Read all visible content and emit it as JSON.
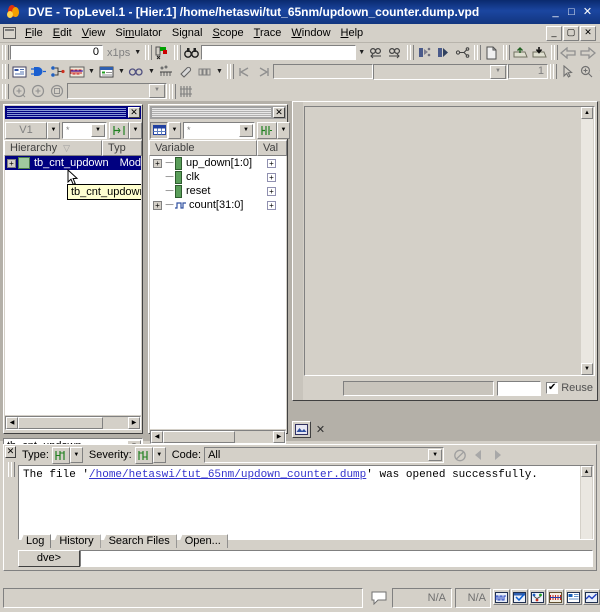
{
  "window": {
    "title": "DVE - TopLevel.1 - [Hier.1]  /home/hetaswi/tut_65nm/updown_counter.dump.vpd",
    "logo_icon": "dve-flame-logo-icon",
    "minimize_label": "_",
    "maximize_label": "□",
    "close_label": "✕"
  },
  "menubar": {
    "window_icon": "window-menu-icon",
    "items": [
      {
        "label": "File"
      },
      {
        "label": "Edit"
      },
      {
        "label": "View"
      },
      {
        "label": "Simulator"
      },
      {
        "label": "Signal"
      },
      {
        "label": "Scope"
      },
      {
        "label": "Trace"
      },
      {
        "label": "Window"
      },
      {
        "label": "Help"
      }
    ],
    "mdi_buttons": [
      {
        "label": "_",
        "name": "mdi-minimize-button"
      },
      {
        "label": "▢",
        "name": "mdi-restore-button"
      },
      {
        "label": "✕",
        "name": "mdi-close-button"
      }
    ]
  },
  "toolbar1": {
    "time_value": "0",
    "time_unit": "x1ps",
    "search_value": "",
    "goto_icon": "goto-time-icon",
    "find_icon": "binoculars-find-icon",
    "find_prev_icon": "find-prev-icon",
    "find_next_icon": "find-next-icon",
    "scope_combo_value": "",
    "add_signal_icon": "add-signal-icon",
    "add_group_icon": "add-group-icon",
    "expand_bus_icon": "expand-bus-icon",
    "new_file_icon": "new-file-icon",
    "open_db_icon": "open-database-icon",
    "save_db_icon": "save-database-icon",
    "back_icon": "navigate-back-icon",
    "forward_icon": "navigate-forward-icon"
  },
  "toolbar2": {
    "source_icon": "source-view-icon",
    "schematic_icon": "schematic-view-icon",
    "path_schematic_icon": "path-schematic-icon",
    "wave_icon": "wave-view-icon",
    "list_icon": "list-view-icon",
    "assertion_icon": "assertion-view-icon",
    "toggle_icon": "toggle-coverage-icon",
    "eraser_icon": "eraser-icon",
    "memory_icon": "memory-view-icon",
    "step_back_icon": "step-back-icon",
    "step_forward_icon": "step-forward-icon",
    "flat_field_value": ""
  },
  "toolbar3": {
    "zoom_out_icon": "zoom-out-circle-icon",
    "zoom_in_icon": "zoom-in-circle-icon",
    "zoom_fit_icon": "zoom-fit-circle-icon",
    "combo_value": "",
    "grid_icon": "grid-icon",
    "count_value": "1",
    "pointer_icon": "pointer-arrow-icon",
    "mag_plus_icon": "magnify-plus-icon",
    "mag_minus_icon": "magnify-minus-icon",
    "pan_hand_icon": "pan-hand-icon",
    "zoom_full_icon": "zoom-full-icon",
    "zoom_2x_icon": "zoom-2x-icon",
    "zoom_half_icon": "zoom-half-icon",
    "zoom_sel_icon": "zoom-selection-icon",
    "zoom_last_icon": "zoom-last-icon"
  },
  "hierarchy_window": {
    "close_label": "✕",
    "design_selector": "V1",
    "filter_value": "*",
    "filter_placeholder": "*",
    "expand_icon": "expand-all-icon",
    "columns": [
      {
        "label": "Hierarchy",
        "sort": "▽"
      },
      {
        "label": "Typ"
      }
    ],
    "rows": [
      {
        "name": "tb_cnt_updown",
        "type": "Mod",
        "selected": true,
        "expandable": true
      }
    ],
    "tooltip": "tb_cnt_updown",
    "status_value": "tb_cnt_updown"
  },
  "variable_window": {
    "close_label": "✕",
    "view_icon": "table-view-icon",
    "filter_value": "*",
    "filter_placeholder": "*",
    "expand_icon": "expand-all-icon",
    "columns": [
      {
        "label": "Variable"
      },
      {
        "label": "Val"
      }
    ],
    "rows": [
      {
        "name": "up_down[1:0]",
        "expandable": true,
        "kind": "signal",
        "value_btn": "+"
      },
      {
        "name": "clk",
        "expandable": false,
        "kind": "signal",
        "value_btn": "+"
      },
      {
        "name": "reset",
        "expandable": false,
        "kind": "signal",
        "value_btn": "+"
      },
      {
        "name": "count[31:0]",
        "expandable": true,
        "kind": "bus",
        "value_btn": "+"
      }
    ]
  },
  "right_pane": {
    "field_value": "",
    "small_field_value": "",
    "reuse_label": "Reuse",
    "reuse_checked": true,
    "reuse_mark": "✔",
    "tab_icon": "pane-tab-icon",
    "tab_close_label": "✕"
  },
  "log_panel": {
    "close_label": "✕",
    "type_label": "Type:",
    "type_icon": "type-filter-icon",
    "severity_label": "Severity:",
    "severity_icon": "severity-filter-icon",
    "code_label": "Code:",
    "code_value": "All",
    "clear_icon": "clear-messages-icon",
    "prev_icon": "prev-message-icon",
    "next_icon": "next-message-icon",
    "message_prefix": "The file '",
    "message_link": "/home/hetaswi/tut_65nm/updown_counter.dump",
    "message_suffix": "' was opened successfully.",
    "tabs": [
      {
        "label": "Log",
        "active": true
      },
      {
        "label": "History",
        "active": false
      },
      {
        "label": "Search Files",
        "active": false
      },
      {
        "label": "Open...",
        "active": false
      }
    ],
    "prompt_label": "dve>",
    "prompt_value": ""
  },
  "statusbar": {
    "message_icon": "message-balloon-icon",
    "field1": "N/A",
    "field2": "N/A",
    "icons": [
      {
        "name": "open-wave-window-icon"
      },
      {
        "name": "open-list-window-icon"
      },
      {
        "name": "open-schematic-window-icon"
      },
      {
        "name": "open-path-schematic-icon"
      },
      {
        "name": "open-source-window-icon"
      },
      {
        "name": "open-memory-window-icon"
      }
    ]
  },
  "colors": {
    "title_blue": "#000080",
    "face": "#d4d0c8",
    "link": "#3333cc",
    "tooltip_bg": "#ffffd0"
  }
}
